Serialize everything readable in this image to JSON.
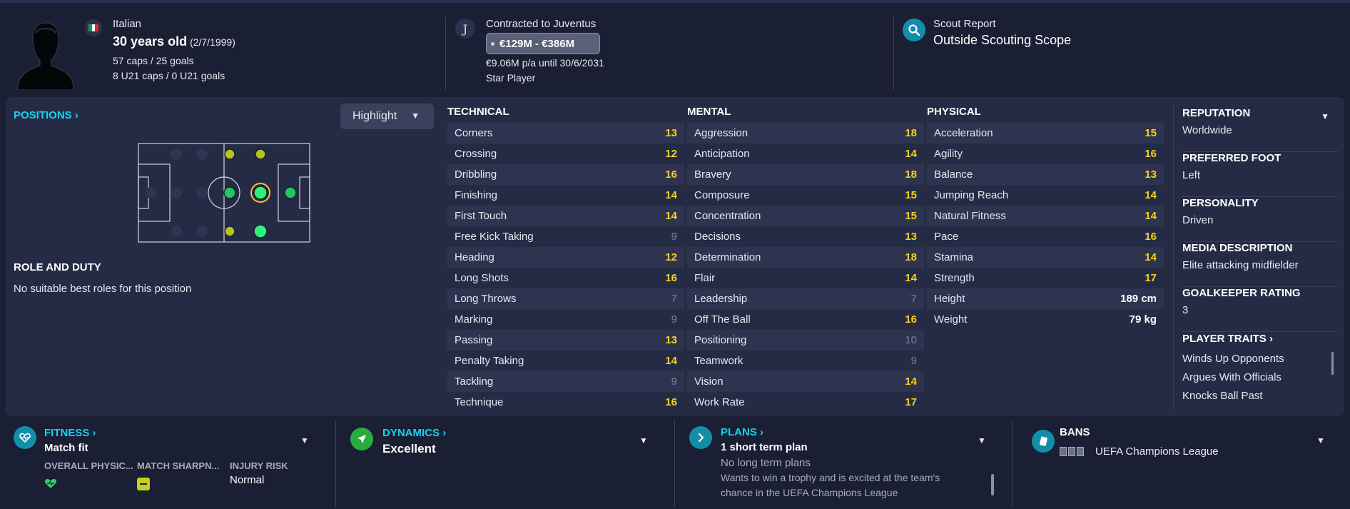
{
  "header": {
    "nationality": "Italian",
    "age": "30 years old",
    "dob": "(2/7/1999)",
    "caps": "57 caps / 25 goals",
    "u21": "8 U21 caps / 0 U21 goals",
    "contract": "Contracted to Juventus",
    "value_range": "€129M - €386M",
    "wage": "€9.06M p/a until 30/6/2031",
    "status": "Star Player",
    "scout_label": "Scout Report",
    "scout_value": "Outside Scouting Scope",
    "club_badge_glyph": "J"
  },
  "positions": {
    "title": "POSITIONS",
    "highlight_label": "Highlight",
    "role_title": "ROLE AND DUTY",
    "role_text": "No suitable best roles for this position"
  },
  "attributes": {
    "technical": {
      "title": "TECHNICAL",
      "rows": [
        {
          "name": "Corners",
          "value": "13",
          "tone": "hi"
        },
        {
          "name": "Crossing",
          "value": "12",
          "tone": "hi"
        },
        {
          "name": "Dribbling",
          "value": "16",
          "tone": "hi"
        },
        {
          "name": "Finishing",
          "value": "14",
          "tone": "hi"
        },
        {
          "name": "First Touch",
          "value": "14",
          "tone": "hi"
        },
        {
          "name": "Free Kick Taking",
          "value": "9",
          "tone": "lo"
        },
        {
          "name": "Heading",
          "value": "12",
          "tone": "hi"
        },
        {
          "name": "Long Shots",
          "value": "16",
          "tone": "hi"
        },
        {
          "name": "Long Throws",
          "value": "7",
          "tone": "lo"
        },
        {
          "name": "Marking",
          "value": "9",
          "tone": "lo"
        },
        {
          "name": "Passing",
          "value": "13",
          "tone": "hi"
        },
        {
          "name": "Penalty Taking",
          "value": "14",
          "tone": "hi"
        },
        {
          "name": "Tackling",
          "value": "9",
          "tone": "lo"
        },
        {
          "name": "Technique",
          "value": "16",
          "tone": "hi"
        }
      ]
    },
    "mental": {
      "title": "MENTAL",
      "rows": [
        {
          "name": "Aggression",
          "value": "18",
          "tone": "hi"
        },
        {
          "name": "Anticipation",
          "value": "14",
          "tone": "hi"
        },
        {
          "name": "Bravery",
          "value": "18",
          "tone": "hi"
        },
        {
          "name": "Composure",
          "value": "15",
          "tone": "hi"
        },
        {
          "name": "Concentration",
          "value": "15",
          "tone": "hi"
        },
        {
          "name": "Decisions",
          "value": "13",
          "tone": "hi"
        },
        {
          "name": "Determination",
          "value": "18",
          "tone": "hi"
        },
        {
          "name": "Flair",
          "value": "14",
          "tone": "hi"
        },
        {
          "name": "Leadership",
          "value": "7",
          "tone": "lo"
        },
        {
          "name": "Off The Ball",
          "value": "16",
          "tone": "hi"
        },
        {
          "name": "Positioning",
          "value": "10",
          "tone": "lo"
        },
        {
          "name": "Teamwork",
          "value": "9",
          "tone": "lo"
        },
        {
          "name": "Vision",
          "value": "14",
          "tone": "hi"
        },
        {
          "name": "Work Rate",
          "value": "17",
          "tone": "hi"
        }
      ]
    },
    "physical": {
      "title": "PHYSICAL",
      "rows": [
        {
          "name": "Acceleration",
          "value": "15",
          "tone": "hi"
        },
        {
          "name": "Agility",
          "value": "16",
          "tone": "hi"
        },
        {
          "name": "Balance",
          "value": "13",
          "tone": "hi"
        },
        {
          "name": "Jumping Reach",
          "value": "14",
          "tone": "hi"
        },
        {
          "name": "Natural Fitness",
          "value": "14",
          "tone": "hi"
        },
        {
          "name": "Pace",
          "value": "16",
          "tone": "hi"
        },
        {
          "name": "Stamina",
          "value": "14",
          "tone": "hi"
        },
        {
          "name": "Strength",
          "value": "17",
          "tone": "hi"
        },
        {
          "name": "Height",
          "value": "189 cm",
          "tone": "w"
        },
        {
          "name": "Weight",
          "value": "79 kg",
          "tone": "w"
        }
      ]
    }
  },
  "info": {
    "reputation_label": "REPUTATION",
    "reputation_value": "Worldwide",
    "foot_label": "PREFERRED FOOT",
    "foot_value": "Left",
    "personality_label": "PERSONALITY",
    "personality_value": "Driven",
    "media_label": "MEDIA DESCRIPTION",
    "media_value": "Elite attacking midfielder",
    "gk_label": "GOALKEEPER RATING",
    "gk_value": "3",
    "traits_title": "PLAYER TRAITS",
    "traits": [
      "Winds Up Opponents",
      "Argues With Officials",
      "Knocks Ball Past"
    ]
  },
  "bottom": {
    "fitness": {
      "title": "FITNESS",
      "value": "Match fit",
      "overall_label": "OVERALL PHYSIC...",
      "sharpness_label": "MATCH SHARPN...",
      "injury_label": "INJURY RISK",
      "injury_value": "Normal"
    },
    "dynamics": {
      "title": "DYNAMICS",
      "value": "Excellent"
    },
    "plans": {
      "title": "PLANS",
      "value": "1 short term plan",
      "no_long": "No long term plans",
      "desc_line1": "Wants to win a trophy and is excited at the team's",
      "desc_line2": "chance in the UEFA Champions League"
    },
    "bans": {
      "title": "BANS",
      "competition": "UEFA Champions League"
    }
  },
  "colors": {
    "accent": "#18d2ee",
    "attr_high": "#f5d21f",
    "attr_low": "#7c8198",
    "panel": "#262b45",
    "background": "#1b1f33",
    "fitness_green": "#2fd06a"
  }
}
